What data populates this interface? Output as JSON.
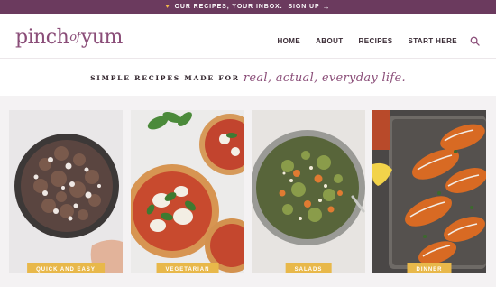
{
  "promo": {
    "text": "OUR RECIPES, YOUR INBOX.",
    "cta": "SIGN UP",
    "arrow": "→"
  },
  "logo": {
    "part1": "pinch",
    "part2": "of",
    "part3": "yum"
  },
  "nav": {
    "items": [
      "HOME",
      "ABOUT",
      "RECIPES",
      "START HERE"
    ]
  },
  "tagline": {
    "main": "SIMPLE RECIPES MADE FOR",
    "script": "real, actual, everyday life."
  },
  "categories": [
    {
      "label": "QUICK AND EASY"
    },
    {
      "label": "VEGETARIAN"
    },
    {
      "label": "SALADS"
    },
    {
      "label": "DINNER"
    }
  ],
  "colors": {
    "brand": "#6b3a5e",
    "logo": "#8a4d78",
    "label": "#e8b84a"
  }
}
